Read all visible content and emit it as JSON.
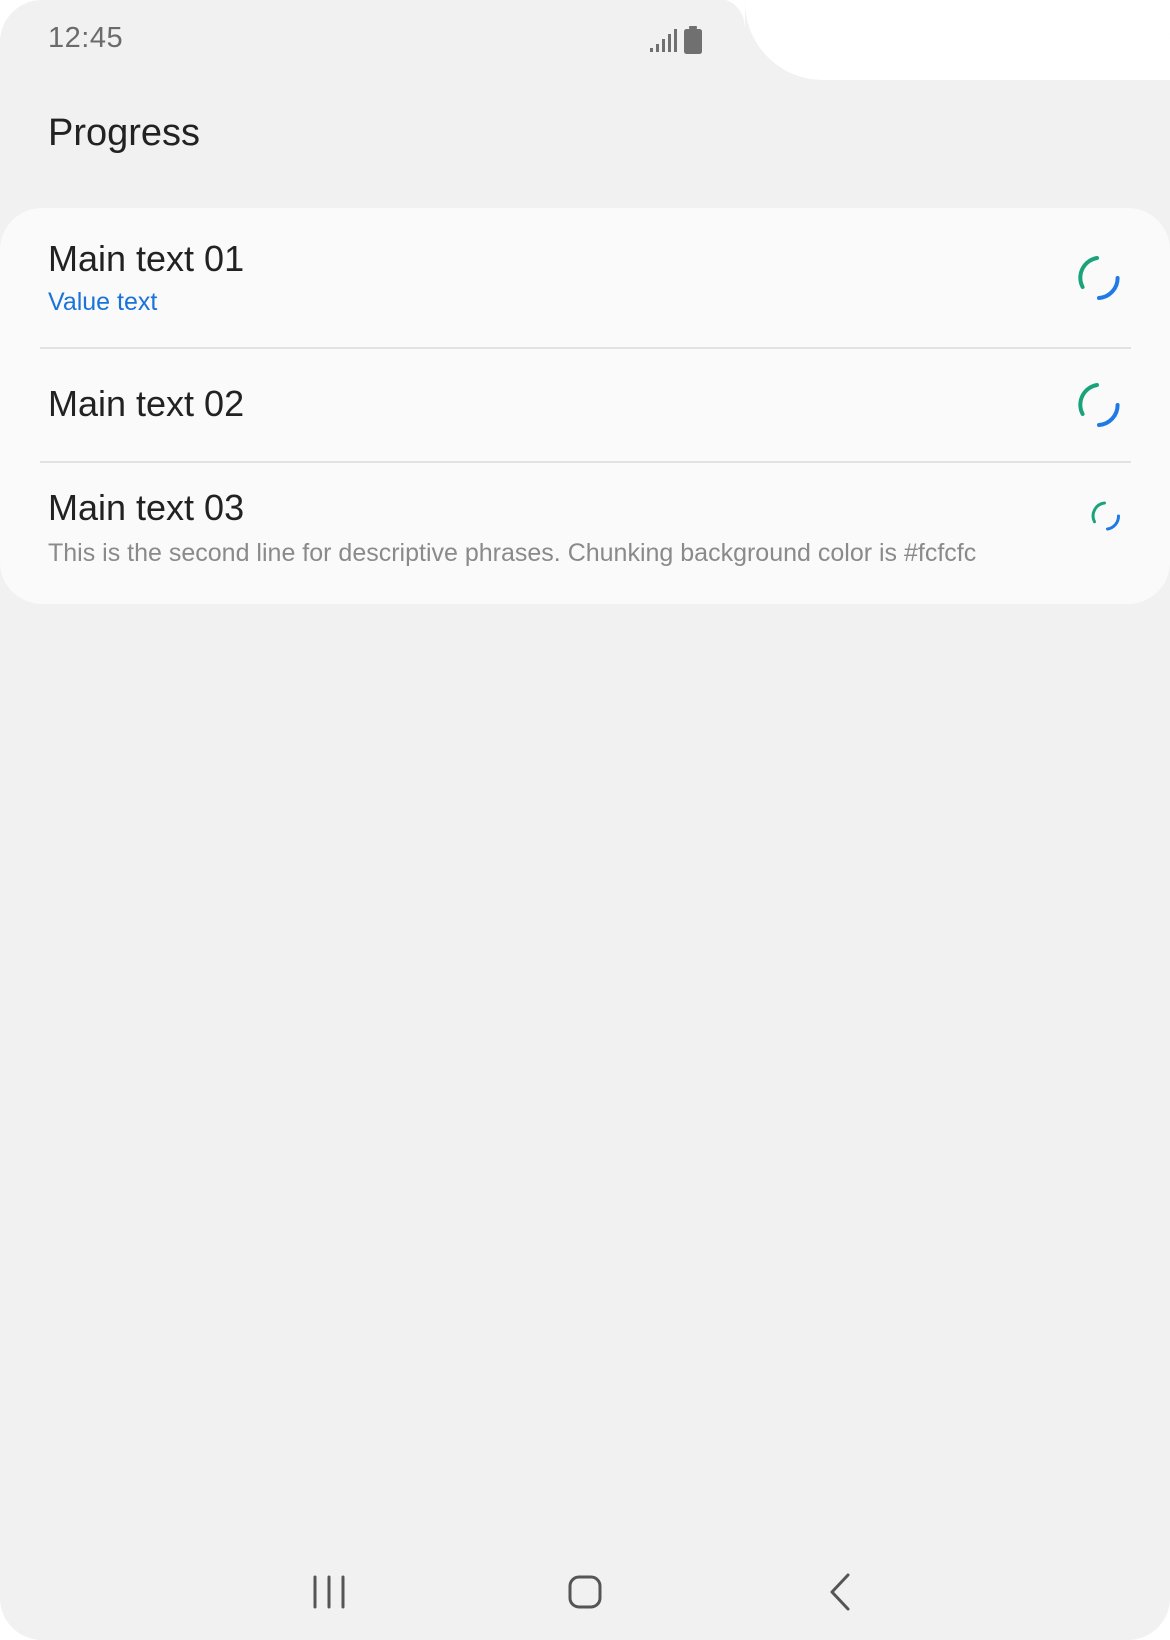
{
  "status_bar": {
    "time": "12:45"
  },
  "header": {
    "title": "Progress"
  },
  "list": {
    "background_color": "#fafafa",
    "items": [
      {
        "main": "Main text 01",
        "value": "Value text",
        "spinner": "progress-spinner-large"
      },
      {
        "main": "Main text 02",
        "spinner": "progress-spinner-large"
      },
      {
        "main": "Main text 03",
        "description": "This is the second line for descriptive phrases. Chunking background color is #fcfcfc",
        "spinner": "progress-spinner-small"
      }
    ]
  },
  "colors": {
    "accent_blue": "#1a73d9",
    "spinner_green": "#1aa37a",
    "spinner_blue": "#1f7ae6",
    "screen_background": "#f1f1f1"
  },
  "navigation": {
    "buttons": [
      "recent-apps-icon",
      "home-icon",
      "back-icon"
    ]
  }
}
